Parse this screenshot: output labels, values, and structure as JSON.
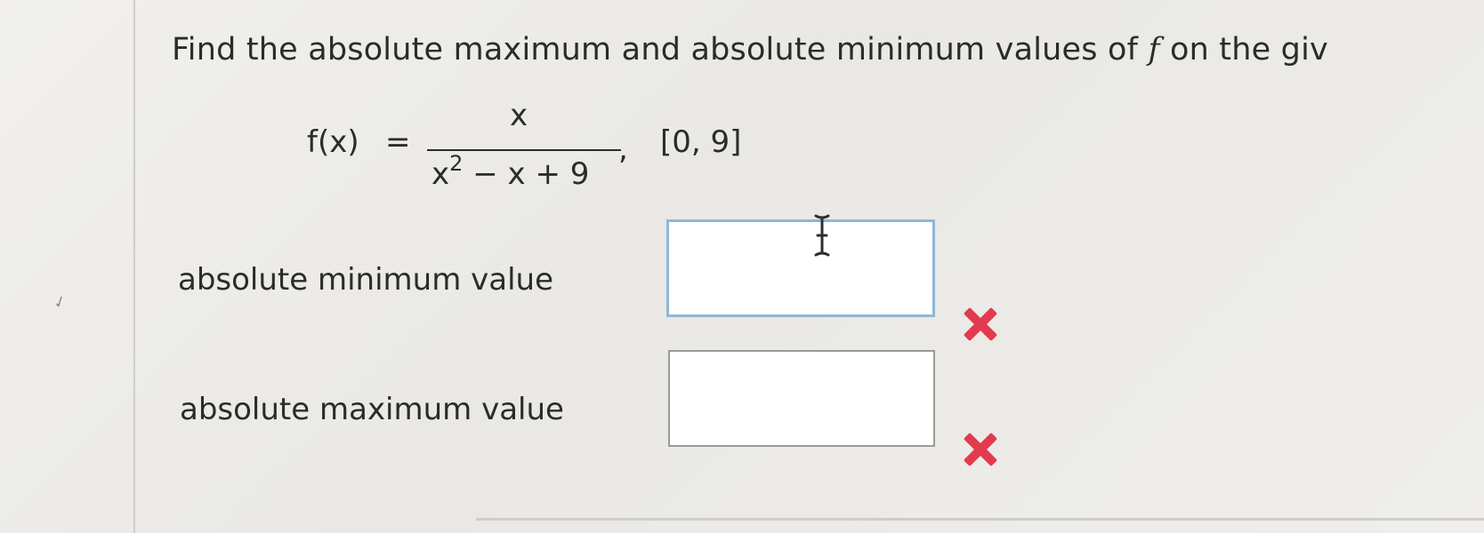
{
  "question": {
    "prefix": "Find the absolute maximum and absolute minimum values of ",
    "italic_symbol": "f",
    "suffix": " on the giv"
  },
  "formula": {
    "lhs": "f(x)",
    "equals": "=",
    "numerator": "x",
    "denominator_base": "x",
    "denominator_exponent": "2",
    "denominator_rest": " − x + 9",
    "comma": ",",
    "interval": "[0, 9]"
  },
  "answers": {
    "min_label": "absolute minimum value",
    "min_value": "",
    "max_label": "absolute maximum value",
    "max_value": ""
  },
  "status": {
    "min_state": "incorrect",
    "max_state": "incorrect",
    "incorrect_color": "#e23a4e"
  },
  "icons": {
    "incorrect": "x-mark-icon",
    "cursor": "text-cursor-icon",
    "margin_mark": "checkmark-icon"
  }
}
